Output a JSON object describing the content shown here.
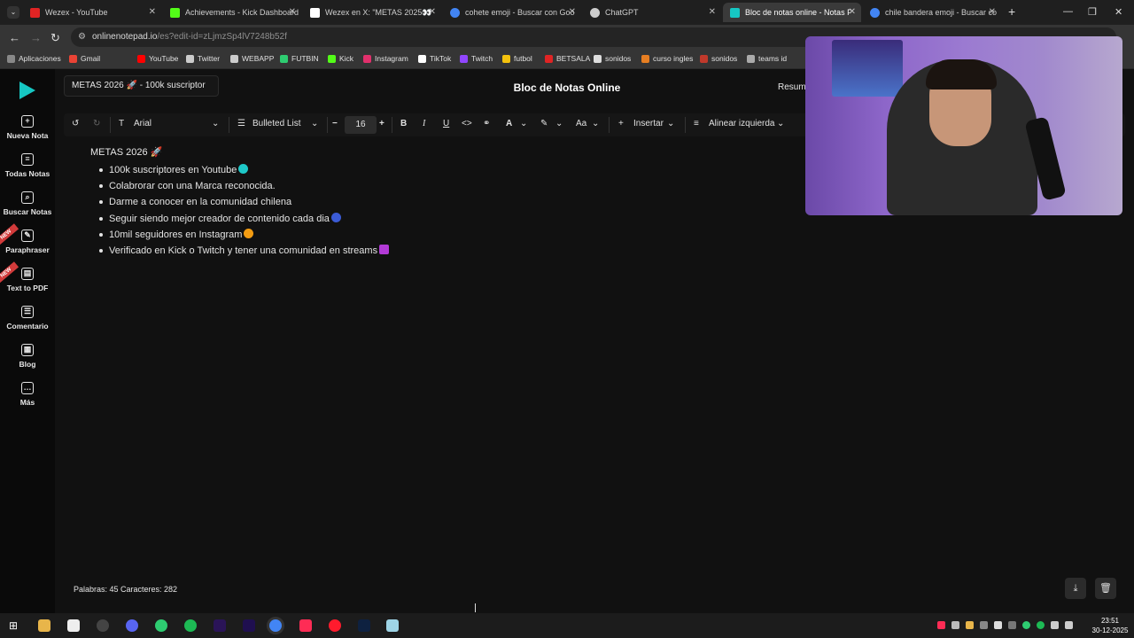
{
  "browser": {
    "tabs": [
      {
        "title": "Wezex - YouTube",
        "color": "#e02424"
      },
      {
        "title": "Achievements - Kick Dashboard",
        "color": "#53fc18"
      },
      {
        "title": "Wezex en X: \"METAS 2025👀",
        "color": "#ffffff"
      },
      {
        "title": "cohete emoji - Buscar con Goo",
        "color": "#4285f4"
      },
      {
        "title": "ChatGPT",
        "color": "#cccccc"
      },
      {
        "title": "Bloc de notas online - Notas P",
        "color": "#16c7c3"
      },
      {
        "title": "chile bandera emoji - Buscar co",
        "color": "#4285f4"
      }
    ],
    "new_tab": "+",
    "url_host": "onlinenotepad.io",
    "url_path": "/es?edit-id=zLjmzSp4lV7248b52f",
    "bookmarks": [
      {
        "label": "Aplicaciones",
        "color": "#888888"
      },
      {
        "label": "Gmail",
        "color": "#ea4335"
      },
      {
        "label": "YouTube",
        "color": "#ff0000"
      },
      {
        "label": "Twitter",
        "color": "#cccccc"
      },
      {
        "label": "WEBAPP",
        "color": "#cccccc"
      },
      {
        "label": "FUTBIN",
        "color": "#2ecc71"
      },
      {
        "label": "Kick",
        "color": "#53fc18"
      },
      {
        "label": "Instagram",
        "color": "#e1306c"
      },
      {
        "label": "TikTok",
        "color": "#ffffff"
      },
      {
        "label": "Twitch",
        "color": "#9146ff"
      },
      {
        "label": "futbol",
        "color": "#f4c20d"
      },
      {
        "label": "BETSALA",
        "color": "#e02424"
      },
      {
        "label": "sonidos",
        "color": "#dddddd"
      },
      {
        "label": "curso ingles",
        "color": "#e67e22"
      },
      {
        "label": "sonidos",
        "color": "#c0392b"
      },
      {
        "label": "teams id",
        "color": "#aaaaaa"
      }
    ]
  },
  "app": {
    "title": "Bloc de Notas Online",
    "note_title_field": "METAS 2026 🚀 - 100k suscriptor",
    "resume_label": "Resum",
    "sidebar": [
      {
        "label": "Nueva Nota",
        "icon": "plus-icon",
        "glyph": "+"
      },
      {
        "label": "Todas Notas",
        "icon": "notes-icon",
        "glyph": "≡"
      },
      {
        "label": "Buscar Notas",
        "icon": "search-icon",
        "glyph": "⌕"
      },
      {
        "label": "Paraphraser",
        "icon": "paraphrase-icon",
        "glyph": "✎",
        "badge": "NEW"
      },
      {
        "label": "Text to PDF",
        "icon": "pdf-icon",
        "glyph": "▤",
        "badge": "NEW"
      },
      {
        "label": "Comentario",
        "icon": "comment-icon",
        "glyph": "☰"
      },
      {
        "label": "Blog",
        "icon": "blog-icon",
        "glyph": "▦"
      },
      {
        "label": "Más",
        "icon": "more-icon",
        "glyph": "…"
      }
    ],
    "toolbar": {
      "font": "Arial",
      "list_style": "Bulleted List",
      "font_size": "16",
      "bold": "B",
      "italic": "I",
      "underline": "U",
      "code": "<>",
      "font_color": "A",
      "case": "Aa",
      "insert": "Insertar",
      "align": "Alinear izquierda"
    },
    "note": {
      "heading": "METAS 2026 🚀",
      "items": [
        {
          "text": "100k suscriptores en Youtube",
          "emoji_color": "#1ec8c8"
        },
        {
          "text": "Colabrorar con una Marca reconocida.",
          "emoji_color": ""
        },
        {
          "text": "Darme a conocer en la comunidad chilena",
          "emoji_color": ""
        },
        {
          "text": "Seguir siendo mejor creador de contenido cada dia",
          "emoji_color": "#3b5bd6"
        },
        {
          "text": "10mil seguidores en Instagram",
          "emoji_color": "#f39c12"
        },
        {
          "text": "Verificado en Kick o Twitch y tener una comunidad en streams",
          "emoji_color": "#b23ad6"
        }
      ]
    },
    "status": "Palabras: 45  Caracteres: 282"
  },
  "taskbar": {
    "time": "23:51",
    "date": "30-12-2025"
  },
  "colors": {
    "accent": "#16c7c3",
    "background": "#111111",
    "sidebar": "#0a0a0a"
  }
}
